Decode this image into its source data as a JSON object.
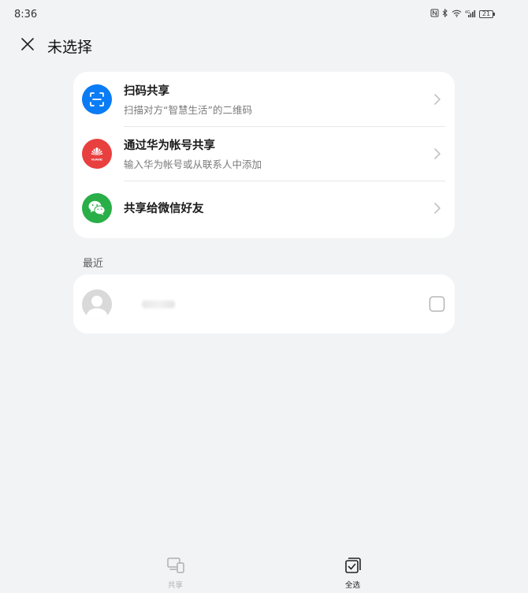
{
  "status_bar": {
    "time": "8:36",
    "battery": "21"
  },
  "header": {
    "title": "未选择"
  },
  "options": [
    {
      "title": "扫码共享",
      "subtitle": "扫描对方“智慧生活”的二维码",
      "icon": "scan-icon",
      "color": "#0a7cf5"
    },
    {
      "title": "通过华为帐号共享",
      "subtitle": "输入华为帐号或从联系人中添加",
      "icon": "huawei-logo-icon",
      "color": "#e8403f",
      "brand_text": "HUAWEI"
    },
    {
      "title": "共享给微信好友",
      "subtitle": "",
      "icon": "wechat-icon",
      "color": "#2aae48"
    }
  ],
  "recent": {
    "label": "最近"
  },
  "bottom_tabs": [
    {
      "label": "共享",
      "icon": "share-devices-icon",
      "active": false
    },
    {
      "label": "全选",
      "icon": "select-all-icon",
      "active": true
    }
  ]
}
